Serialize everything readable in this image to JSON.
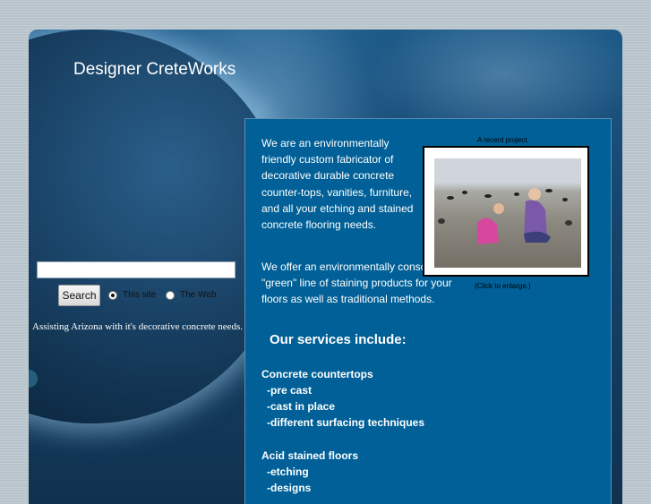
{
  "site": {
    "title": "Designer CreteWorks",
    "tagline": "Assisting Arizona with it's decorative concrete needs."
  },
  "search": {
    "value": "",
    "placeholder": "",
    "button_label": "Search",
    "options": [
      {
        "label": "This site",
        "checked": true
      },
      {
        "label": "The Web",
        "checked": false
      }
    ]
  },
  "content": {
    "intro_paragraph_1": "We are an environmentally friendly custom fabricator of decorative durable concrete counter-tops, vanities, furniture, and all your etching and stained concrete flooring needs.",
    "intro_paragraph_2": "We offer an environmentally conscious  \"green\" line of staining products for your floors as well as traditional methods.",
    "photo": {
      "caption_top": "A recent project.",
      "caption_bottom": "(Click to enlarge.)"
    },
    "services_heading": "Our services include:",
    "service_groups": [
      {
        "title": "Concrete countertops",
        "items": [
          "-pre cast",
          "-cast in place",
          "-different surfacing techniques"
        ]
      },
      {
        "title": "Acid stained floors",
        "items": [
          "-etching",
          "-designs"
        ]
      }
    ]
  },
  "colors": {
    "content_bg": "#006097",
    "frame_bg": "#16446c",
    "page_bg": "#b7c3cb"
  }
}
